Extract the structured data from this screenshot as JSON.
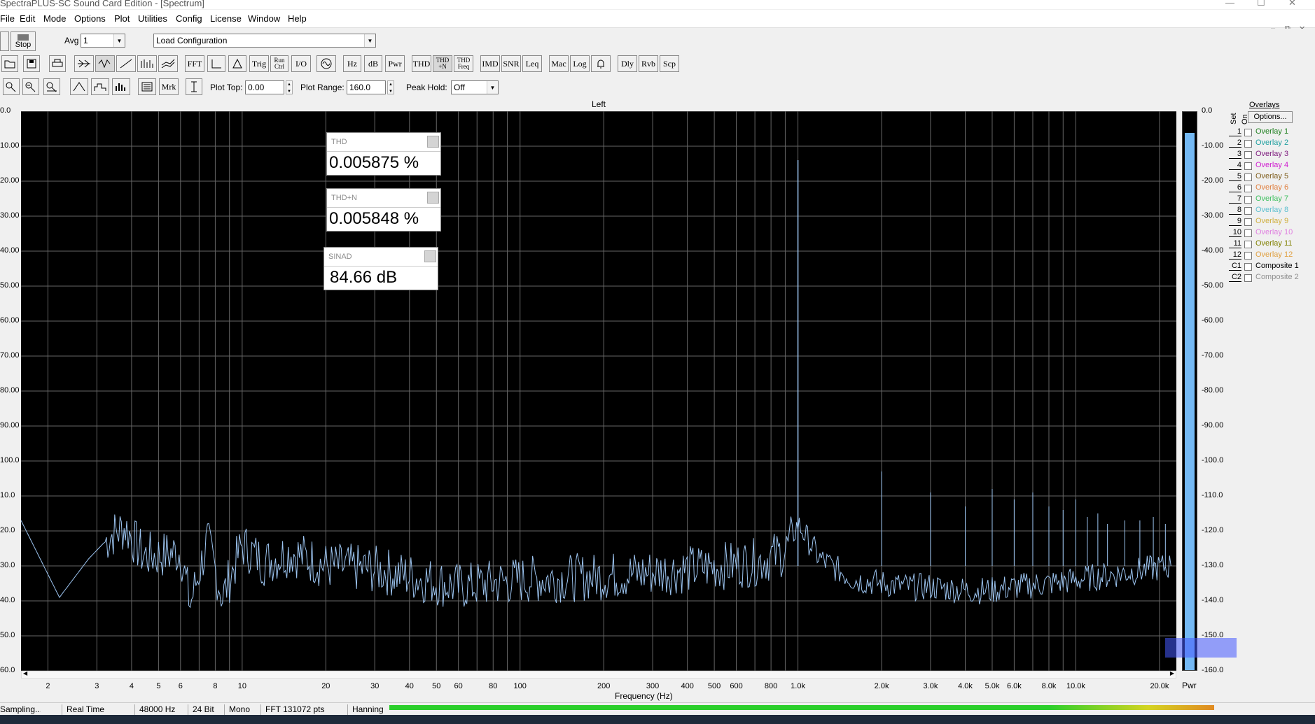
{
  "app": {
    "title": "SpectraPLUS-SC Sound Card Edition - [Spectrum]"
  },
  "menu": [
    "File",
    "Edit",
    "Mode",
    "Options",
    "Plot",
    "Utilities",
    "Config",
    "License",
    "Window",
    "Help"
  ],
  "toolbar": {
    "stop_label": "Stop",
    "avg_label": "Avg",
    "avg_value": "1",
    "config_value": "Load Configuration",
    "buttons": [
      "FFT",
      "Trig",
      "Run Ctrl",
      "I/O",
      "Hz",
      "dB",
      "Pwr",
      "THD",
      "THD +N",
      "THD Freq",
      "IMD",
      "SNR",
      "Leq",
      "Mac",
      "Log",
      "Dly",
      "Rvb",
      "Scp"
    ],
    "row2_buttons": [
      "Mrk"
    ],
    "plot_top_label": "Plot Top:",
    "plot_top_value": "0.00",
    "plot_range_label": "Plot Range:",
    "plot_range_value": "160.0",
    "peak_hold_label": "Peak Hold:",
    "peak_hold_value": "Off"
  },
  "plot": {
    "title": "Left",
    "xlabel": "Frequency (Hz)",
    "meter_label": "Pwr"
  },
  "measurements": [
    {
      "name": "THD",
      "value": "0.005875 %"
    },
    {
      "name": "THD+N",
      "value": "0.005848 %"
    },
    {
      "name": "SINAD",
      "value": "84.66 dB"
    }
  ],
  "overlays": {
    "title": "Overlays",
    "options_label": "Options...",
    "col_set": "Set",
    "col_on": "On",
    "items": [
      {
        "num": "1",
        "name": "Overlay 1",
        "color": "#208020"
      },
      {
        "num": "2",
        "name": "Overlay 2",
        "color": "#20a0a0"
      },
      {
        "num": "3",
        "name": "Overlay 3",
        "color": "#802080"
      },
      {
        "num": "4",
        "name": "Overlay 4",
        "color": "#d020d0"
      },
      {
        "num": "5",
        "name": "Overlay 5",
        "color": "#806020"
      },
      {
        "num": "6",
        "name": "Overlay 6",
        "color": "#e08040"
      },
      {
        "num": "7",
        "name": "Overlay 7",
        "color": "#40c060"
      },
      {
        "num": "8",
        "name": "Overlay 8",
        "color": "#60c0d0"
      },
      {
        "num": "9",
        "name": "Overlay 9",
        "color": "#d0b040"
      },
      {
        "num": "10",
        "name": "Overlay 10",
        "color": "#e080e0"
      },
      {
        "num": "11",
        "name": "Overlay 11",
        "color": "#808000"
      },
      {
        "num": "12",
        "name": "Overlay 12",
        "color": "#e0a040"
      },
      {
        "num": "C1",
        "name": "Composite 1",
        "color": "#000000"
      },
      {
        "num": "C2",
        "name": "Composite 2",
        "color": "#909090"
      }
    ]
  },
  "status": [
    "Sampling...",
    "Real Time",
    "48000 Hz",
    "24 Bit",
    "Mono",
    "FFT 131072 pts",
    "Hanning"
  ],
  "chart_data": {
    "type": "line",
    "title": "Left",
    "xlabel": "Frequency (Hz)",
    "ylabel": "",
    "xscale": "log",
    "xlim": [
      1.6,
      23000
    ],
    "ylim": [
      -160,
      0
    ],
    "grid": true,
    "y_ticks": [
      "0.0",
      "-10.00",
      "-20.00",
      "-30.00",
      "-40.00",
      "-50.00",
      "-60.00",
      "-70.00",
      "-80.00",
      "-90.00",
      "-100.0",
      "-110.0",
      "-120.0",
      "-130.0",
      "-140.0",
      "-150.0",
      "-160.0"
    ],
    "y_ticks_left": [
      "0.0",
      "10.00",
      "20.00",
      "30.00",
      "40.00",
      "50.00",
      "60.00",
      "70.00",
      "80.00",
      "90.00",
      "100.0",
      "10.0",
      "20.0",
      "30.0",
      "40.0",
      "50.0",
      "60.0"
    ],
    "x_ticks": [
      "2",
      "3",
      "4",
      "5",
      "6",
      "8",
      "10",
      "20",
      "30",
      "40",
      "50",
      "60",
      "80",
      "100",
      "200",
      "300",
      "400",
      "500",
      "600",
      "800",
      "1.0k",
      "2.0k",
      "3.0k",
      "4.0k",
      "5.0k",
      "6.0k",
      "8.0k",
      "10.0k",
      "20.0k"
    ],
    "x_tick_values": [
      2,
      3,
      4,
      5,
      6,
      8,
      10,
      20,
      30,
      40,
      50,
      60,
      80,
      100,
      200,
      300,
      400,
      500,
      600,
      800,
      1000,
      2000,
      3000,
      4000,
      5000,
      6000,
      8000,
      10000,
      20000
    ],
    "series": [
      {
        "color": "#9cc4f0",
        "x": [
          1.6,
          2.2,
          2.8,
          3.4,
          3.8,
          4.4,
          5.0,
          6.0,
          6.5,
          7.5,
          8.5,
          10,
          12,
          15,
          20,
          30,
          40,
          60,
          100,
          200,
          400,
          700,
          900,
          1000,
          1200,
          1600,
          2000,
          2500,
          3000,
          4000,
          5000,
          6000,
          8000,
          10000,
          15000,
          22000
        ],
        "y": [
          -117,
          -139,
          -128,
          -121,
          -119,
          -127,
          -127,
          -126,
          -141,
          -123,
          -139,
          -124,
          -129,
          -126,
          -130,
          -131,
          -133,
          -136,
          -134,
          -133,
          -131,
          -129,
          -126,
          -118,
          -128,
          -134,
          -135,
          -136,
          -136,
          -137,
          -137,
          -136,
          -135,
          -134,
          -132,
          -130
        ]
      }
    ],
    "peaks": [
      {
        "x": 1000,
        "y": -14
      },
      {
        "x": 2000,
        "y": -103
      },
      {
        "x": 3000,
        "y": -109
      },
      {
        "x": 4000,
        "y": -113
      },
      {
        "x": 5000,
        "y": -108
      },
      {
        "x": 6000,
        "y": -111
      },
      {
        "x": 7000,
        "y": -109
      },
      {
        "x": 8000,
        "y": -113
      },
      {
        "x": 9000,
        "y": -114
      },
      {
        "x": 10000,
        "y": -111
      },
      {
        "x": 11000,
        "y": -116
      },
      {
        "x": 12000,
        "y": -115
      },
      {
        "x": 13000,
        "y": -118
      },
      {
        "x": 15000,
        "y": -117
      },
      {
        "x": 17000,
        "y": -117
      },
      {
        "x": 19000,
        "y": -116
      },
      {
        "x": 21000,
        "y": -118
      }
    ],
    "meter_level_db": -6
  }
}
